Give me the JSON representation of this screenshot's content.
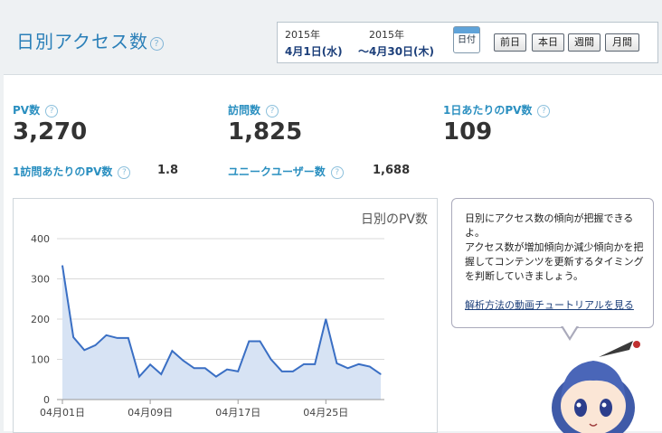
{
  "header": {
    "title": "日別アクセス数",
    "help": "?",
    "start_year": "2015年",
    "start_date": "4月1日(水)",
    "end_year": "2015年",
    "end_date": "～4月30日(木)",
    "calendar_label": "日付",
    "buttons": [
      "前日",
      "本日",
      "週間",
      "月間"
    ]
  },
  "metrics": {
    "pv_label": "PV数",
    "pv_value": "3,270",
    "visits_label": "訪問数",
    "visits_value": "1,825",
    "daily_label": "1日あたりのPV数",
    "daily_value": "109",
    "per_visit_label": "1訪問あたりのPV数",
    "per_visit_value": "1.8",
    "unique_label": "ユニークユーザー数",
    "unique_value": "1,688"
  },
  "tip": {
    "line1": "日別にアクセス数の傾向が把握できるよ。",
    "line2": "アクセス数が増加傾向か減少傾向かを把握してコンテンツを更新するタイミングを判断していきましょう。",
    "link": "解析方法の動画チュートリアルを見る"
  },
  "chart_data": {
    "type": "area",
    "title": "日別のPV数",
    "ylim": [
      0,
      400
    ],
    "yticks": [
      "0",
      "100",
      "200",
      "300",
      "400"
    ],
    "xticks": [
      {
        "day": 1,
        "label": "04月01日"
      },
      {
        "day": 9,
        "label": "04月09日"
      },
      {
        "day": 17,
        "label": "04月17日"
      },
      {
        "day": 25,
        "label": "04月25日"
      }
    ],
    "x": [
      1,
      2,
      3,
      4,
      5,
      6,
      7,
      8,
      9,
      10,
      11,
      12,
      13,
      14,
      15,
      16,
      17,
      18,
      19,
      20,
      21,
      22,
      23,
      24,
      25,
      26,
      27,
      28,
      29,
      30
    ],
    "values": [
      333,
      155,
      123,
      135,
      160,
      153,
      153,
      57,
      87,
      63,
      121,
      97,
      78,
      78,
      57,
      75,
      70,
      145,
      145,
      100,
      70,
      70,
      88,
      88,
      200,
      90,
      78,
      88,
      82,
      63
    ],
    "color": "#3a6fc4",
    "fill": "#d7e3f4"
  }
}
